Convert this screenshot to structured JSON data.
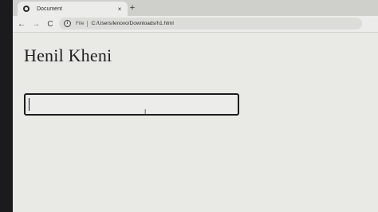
{
  "browser": {
    "tab": {
      "title": "Document",
      "close_glyph": "×",
      "favicon": "globe-icon"
    },
    "new_tab_glyph": "+",
    "toolbar": {
      "back_glyph": "←",
      "forward_glyph": "→",
      "reload_glyph": "C",
      "info_glyph": "i",
      "scheme_label": "File",
      "url": "C:/Users/lenovo/Downloads/h1.html"
    }
  },
  "page": {
    "heading": "Henil Kheni",
    "input": {
      "value": "",
      "placeholder": ""
    },
    "cursor_glyph": "I"
  },
  "colors": {
    "page_background": "#e9e9e5",
    "input_border": "#1c1c1c",
    "tab_strip": "#cfd0cc"
  }
}
